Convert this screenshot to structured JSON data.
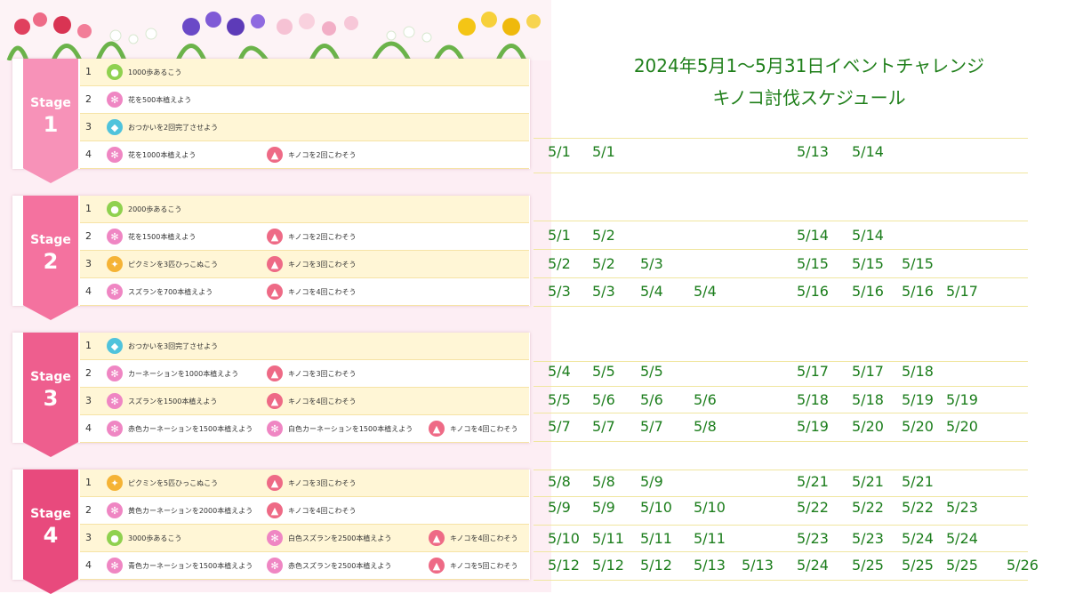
{
  "title": {
    "line1": "2024年5月1〜5月31日イベントチャレンジ",
    "line2": "キノコ討伐スケジュール"
  },
  "colors": {
    "stage1": "#f792b8",
    "stage2": "#f4729f",
    "stage3": "#ee5e8e",
    "stage4": "#e84a7d",
    "date_text": "#1b7d1b",
    "title_text": "#1f7f1a"
  },
  "stages": [
    {
      "label": "Stage",
      "number": "1",
      "rows": [
        {
          "num": "1",
          "tasks": [
            {
              "icon": "footprint-icon",
              "text": "1000歩あるこう"
            }
          ]
        },
        {
          "num": "2",
          "tasks": [
            {
              "icon": "flower-icon",
              "text": "花を500本植えよう"
            }
          ]
        },
        {
          "num": "3",
          "tasks": [
            {
              "icon": "errand-icon",
              "text": "おつかいを2回完了させよう"
            }
          ]
        },
        {
          "num": "4",
          "tasks": [
            {
              "icon": "flower-icon",
              "text": "花を1000本植えよう"
            },
            {
              "icon": "mushroom-icon",
              "text": "キノコを2回こわそう"
            }
          ]
        }
      ]
    },
    {
      "label": "Stage",
      "number": "2",
      "rows": [
        {
          "num": "1",
          "tasks": [
            {
              "icon": "footprint-icon",
              "text": "2000歩あるこう"
            }
          ]
        },
        {
          "num": "2",
          "tasks": [
            {
              "icon": "flower-icon",
              "text": "花を1500本植えよう"
            },
            {
              "icon": "mushroom-icon",
              "text": "キノコを2回こわそう"
            }
          ]
        },
        {
          "num": "3",
          "tasks": [
            {
              "icon": "pikmin-icon",
              "text": "ピクミンを3匹ひっこぬこう"
            },
            {
              "icon": "mushroom-icon",
              "text": "キノコを3回こわそう"
            }
          ]
        },
        {
          "num": "4",
          "tasks": [
            {
              "icon": "flower-icon",
              "text": "スズランを700本植えよう"
            },
            {
              "icon": "mushroom-icon",
              "text": "キノコを4回こわそう"
            }
          ]
        }
      ]
    },
    {
      "label": "Stage",
      "number": "3",
      "rows": [
        {
          "num": "1",
          "tasks": [
            {
              "icon": "errand-icon",
              "text": "おつかいを3回完了させよう"
            }
          ]
        },
        {
          "num": "2",
          "tasks": [
            {
              "icon": "flower-icon",
              "text": "カーネーションを1000本植えよう"
            },
            {
              "icon": "mushroom-icon",
              "text": "キノコを3回こわそう"
            }
          ]
        },
        {
          "num": "3",
          "tasks": [
            {
              "icon": "flower-icon",
              "text": "スズランを1500本植えよう"
            },
            {
              "icon": "mushroom-icon",
              "text": "キノコを4回こわそう"
            }
          ]
        },
        {
          "num": "4",
          "tasks": [
            {
              "icon": "flower-icon",
              "text": "赤色カーネーションを1500本植えよう"
            },
            {
              "icon": "flower-icon",
              "text": "白色カーネーションを1500本植えよう"
            },
            {
              "icon": "mushroom-icon",
              "text": "キノコを4回こわそう"
            }
          ]
        }
      ]
    },
    {
      "label": "Stage",
      "number": "4",
      "rows": [
        {
          "num": "1",
          "tasks": [
            {
              "icon": "pikmin-icon",
              "text": "ピクミンを5匹ひっこぬこう"
            },
            {
              "icon": "mushroom-icon",
              "text": "キノコを3回こわそう"
            }
          ]
        },
        {
          "num": "2",
          "tasks": [
            {
              "icon": "flower-icon",
              "text": "黄色カーネーションを2000本植えよう"
            },
            {
              "icon": "mushroom-icon",
              "text": "キノコを4回こわそう"
            }
          ]
        },
        {
          "num": "3",
          "tasks": [
            {
              "icon": "footprint-icon",
              "text": "3000歩あるこう"
            },
            {
              "icon": "flower-icon",
              "text": "白色スズランを2500本植えよう"
            },
            {
              "icon": "mushroom-icon",
              "text": "キノコを4回こわそう"
            }
          ]
        },
        {
          "num": "4",
          "tasks": [
            {
              "icon": "flower-icon",
              "text": "青色カーネーションを1500本植えよう"
            },
            {
              "icon": "flower-icon",
              "text": "赤色スズランを2500本植えよう"
            },
            {
              "icon": "mushroom-icon",
              "text": "キノコを5回こわそう"
            }
          ]
        }
      ]
    }
  ],
  "schedule": [
    [
      "5/1",
      "5/1",
      "",
      "",
      "",
      "5/13",
      "5/14",
      "",
      "",
      ""
    ],
    [
      "5/1",
      "5/2",
      "",
      "",
      "",
      "5/14",
      "5/14",
      "",
      "",
      ""
    ],
    [
      "5/2",
      "5/2",
      "5/3",
      "",
      "",
      "5/15",
      "5/15",
      "5/15",
      "",
      ""
    ],
    [
      "5/3",
      "5/3",
      "5/4",
      "5/4",
      "",
      "5/16",
      "5/16",
      "5/16",
      "5/17",
      ""
    ],
    [
      "5/4",
      "5/5",
      "5/5",
      "",
      "",
      "5/17",
      "5/17",
      "5/18",
      "",
      ""
    ],
    [
      "5/5",
      "5/6",
      "5/6",
      "5/6",
      "",
      "5/18",
      "5/18",
      "5/19",
      "5/19",
      ""
    ],
    [
      "5/7",
      "5/7",
      "5/7",
      "5/8",
      "",
      "5/19",
      "5/20",
      "5/20",
      "5/20",
      ""
    ],
    [
      "5/8",
      "5/8",
      "5/9",
      "",
      "",
      "5/21",
      "5/21",
      "5/21",
      "",
      ""
    ],
    [
      "5/9",
      "5/9",
      "5/10",
      "5/10",
      "",
      "5/22",
      "5/22",
      "5/22",
      "5/23",
      ""
    ],
    [
      "5/10",
      "5/11",
      "5/11",
      "5/11",
      "",
      "5/23",
      "5/23",
      "5/24",
      "5/24",
      ""
    ],
    [
      "5/12",
      "5/12",
      "5/12",
      "5/13",
      "5/13",
      "5/24",
      "5/25",
      "5/25",
      "5/25",
      "5/26"
    ]
  ]
}
